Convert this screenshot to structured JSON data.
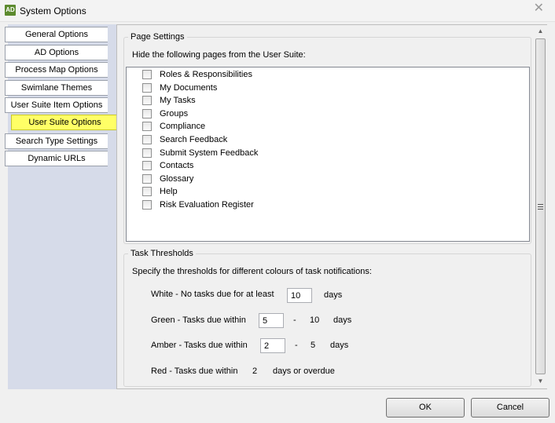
{
  "window": {
    "title": "System Options",
    "icon_text": "AD"
  },
  "sidebar": {
    "tabs": [
      {
        "label": "General Options"
      },
      {
        "label": "AD Options"
      },
      {
        "label": "Process Map Options"
      },
      {
        "label": "Swimlane Themes"
      },
      {
        "label": "User Suite Item Options"
      },
      {
        "label": "User Suite Options"
      },
      {
        "label": "Search Type Settings"
      },
      {
        "label": "Dynamic URLs"
      }
    ],
    "active_index": 5,
    "active_color": "#ffff66"
  },
  "page_settings": {
    "title": "Page Settings",
    "instruction": "Hide the following pages from the User Suite:",
    "pages": [
      {
        "label": "Roles & Responsibilities",
        "checked": false
      },
      {
        "label": "My Documents",
        "checked": false
      },
      {
        "label": "My Tasks",
        "checked": false
      },
      {
        "label": "Groups",
        "checked": false
      },
      {
        "label": "Compliance",
        "checked": false
      },
      {
        "label": "Search Feedback",
        "checked": false
      },
      {
        "label": "Submit System Feedback",
        "checked": false
      },
      {
        "label": "Contacts",
        "checked": false
      },
      {
        "label": "Glossary",
        "checked": false
      },
      {
        "label": "Help",
        "checked": false
      },
      {
        "label": "Risk Evaluation Register",
        "checked": false
      }
    ]
  },
  "task_thresholds": {
    "title": "Task Thresholds",
    "instruction": "Specify the thresholds for different colours of task notifications:",
    "white": {
      "label": "White - No tasks due for at least",
      "value": "10",
      "unit": "days"
    },
    "green": {
      "label": "Green - Tasks due within",
      "value": "5",
      "dash": "-",
      "upper": "10",
      "unit": "days"
    },
    "amber": {
      "label": "Amber - Tasks due within",
      "value": "2",
      "dash": "-",
      "upper": "5",
      "unit": "days"
    },
    "red": {
      "label": "Red - Tasks due within",
      "value": "2",
      "unit": "days or overdue"
    }
  },
  "buttons": {
    "ok": "OK",
    "cancel": "Cancel"
  }
}
